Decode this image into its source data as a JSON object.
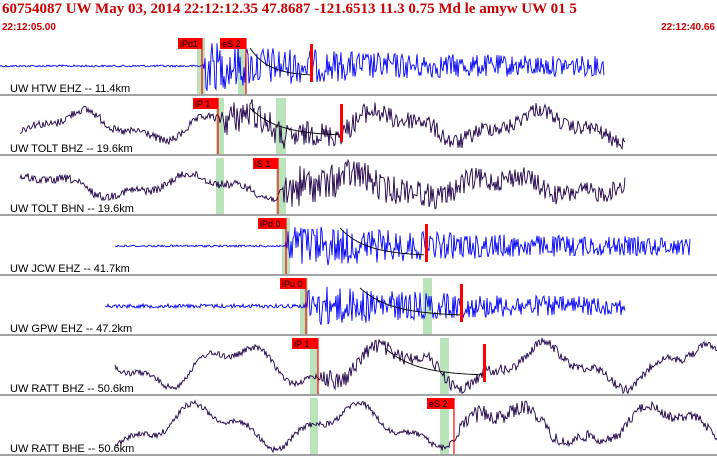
{
  "header": {
    "title": "60754087 UW May 03, 2014 22:12:12.35   47.8687 -121.6513 11.3 0.75 Md le amyw UW 01   5",
    "start_time": "22:12:05.00",
    "end_time": "22:12:40.66"
  },
  "colors": {
    "title": "#cc0000",
    "blue_trace": "#0000ff",
    "dark_trace": "#20004a",
    "pick_box": "#ff0000",
    "pick_window": "#b9e3b9",
    "separator": "#444444"
  },
  "traces": [
    {
      "label": "UW HTW EHZ --",
      "dist": "11.4km",
      "color": "blue",
      "picks": [
        {
          "label": "iPd1"
        },
        {
          "label": "eS 2"
        }
      ]
    },
    {
      "label": "UW TOLT BHZ --",
      "dist": "19.6km",
      "color": "dark",
      "picks": [
        {
          "label": "iP 1"
        }
      ]
    },
    {
      "label": "UW TOLT BHN --",
      "dist": "19.6km",
      "color": "dark",
      "picks": [
        {
          "label": "iS 1"
        }
      ]
    },
    {
      "label": "UW JCW EHZ --",
      "dist": "41.7km",
      "color": "blue",
      "picks": [
        {
          "label": "iPd 0"
        }
      ]
    },
    {
      "label": "UW GPW EHZ --",
      "dist": "47.2km",
      "color": "blue",
      "picks": [
        {
          "label": "iPu 0"
        }
      ]
    },
    {
      "label": "UW RATT BHZ --",
      "dist": "50.6km",
      "color": "dark",
      "picks": [
        {
          "label": "iP 1"
        }
      ]
    },
    {
      "label": "UW RATT BHE --",
      "dist": "50.6km",
      "color": "dark",
      "picks": [
        {
          "label": "eS 2"
        }
      ]
    }
  ]
}
